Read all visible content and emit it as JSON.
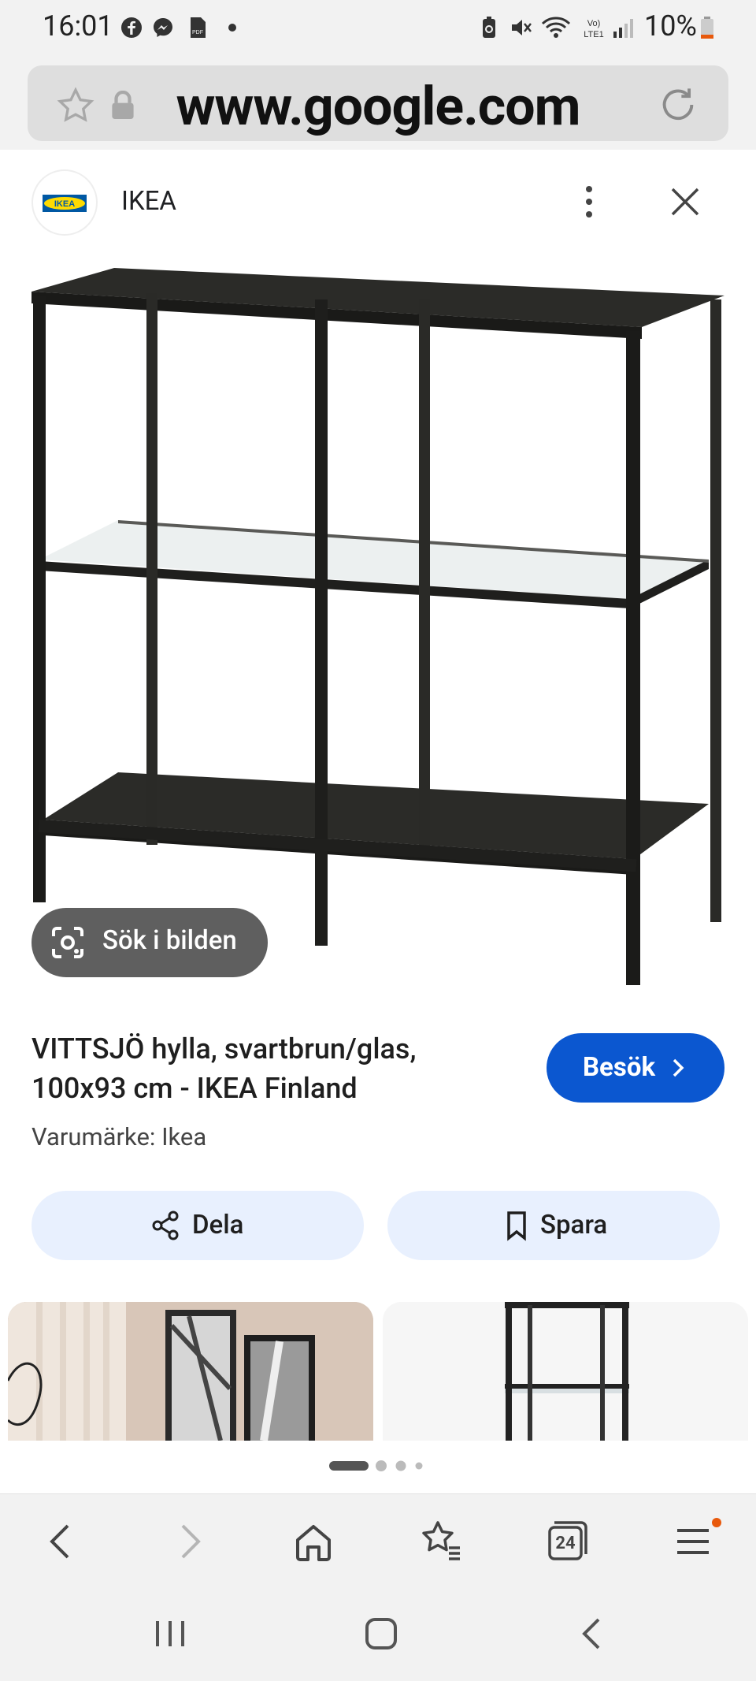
{
  "status_bar": {
    "time": "16:01",
    "battery": "10%",
    "icons_left": [
      "facebook-icon",
      "messenger-icon",
      "pdf-icon",
      "dot-icon"
    ],
    "icons_right": [
      "battery-saver-icon",
      "mute-icon",
      "wifi-icon",
      "volte-icon",
      "signal-icon",
      "battery-icon"
    ],
    "volte_text": "Vo) LTE1"
  },
  "url_bar": {
    "url": "www.google.com",
    "icons": [
      "star-icon",
      "lock-icon",
      "reload-icon"
    ]
  },
  "source": {
    "name": "IKEA",
    "logo_text": "IKEA"
  },
  "product": {
    "lens_label": "Sök i bilden",
    "title": "VITTSJÖ hylla, svartbrun/glas, 100x93 cm - IKEA Finland",
    "brand": "Varumärke: Ikea",
    "visit_label": "Besök",
    "share_label": "Dela",
    "save_label": "Spara"
  },
  "carousel": {
    "dots": 4,
    "active_index": 0
  },
  "toolbar": {
    "tabs_count": "24",
    "icons": [
      "back-icon",
      "forward-icon",
      "home-icon",
      "bookmarks-icon",
      "tabs-icon",
      "menu-icon"
    ]
  },
  "colors": {
    "accent": "#0b57d0",
    "chip": "#5f5f5f",
    "pill": "#e8f0fe",
    "notification": "#e8590c"
  }
}
